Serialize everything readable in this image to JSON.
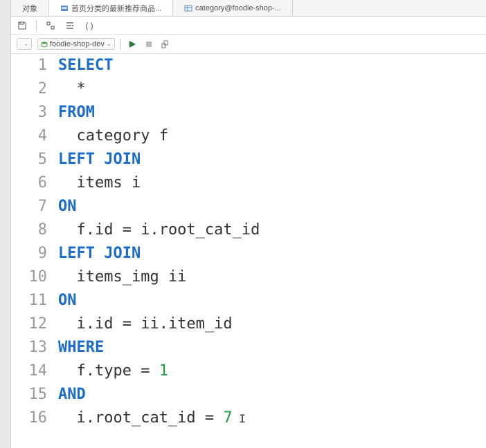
{
  "tabs": {
    "t0": "对象",
    "t1": "首页分类的最新推荐商品...",
    "t2": "category@foodie-shop-..."
  },
  "db_selector": {
    "current": "foodie-shop-dev"
  },
  "code": {
    "lines": [
      {
        "n": 1,
        "segs": [
          {
            "t": "SELECT",
            "c": "kw"
          }
        ]
      },
      {
        "n": 2,
        "segs": [
          {
            "t": "  *",
            "c": ""
          }
        ]
      },
      {
        "n": 3,
        "segs": [
          {
            "t": "FROM",
            "c": "kw"
          }
        ]
      },
      {
        "n": 4,
        "segs": [
          {
            "t": "  category f",
            "c": ""
          }
        ]
      },
      {
        "n": 5,
        "segs": [
          {
            "t": "LEFT JOIN",
            "c": "kw"
          }
        ]
      },
      {
        "n": 6,
        "segs": [
          {
            "t": "  items i",
            "c": ""
          }
        ]
      },
      {
        "n": 7,
        "segs": [
          {
            "t": "ON",
            "c": "kw"
          }
        ]
      },
      {
        "n": 8,
        "segs": [
          {
            "t": "  f.id = i.root_cat_id",
            "c": ""
          }
        ]
      },
      {
        "n": 9,
        "segs": [
          {
            "t": "LEFT JOIN",
            "c": "kw"
          }
        ]
      },
      {
        "n": 10,
        "segs": [
          {
            "t": "  items_img ii",
            "c": ""
          }
        ]
      },
      {
        "n": 11,
        "segs": [
          {
            "t": "ON",
            "c": "kw"
          }
        ]
      },
      {
        "n": 12,
        "segs": [
          {
            "t": "  i.id = ii.item_id",
            "c": ""
          }
        ]
      },
      {
        "n": 13,
        "segs": [
          {
            "t": "WHERE",
            "c": "kw"
          }
        ]
      },
      {
        "n": 14,
        "segs": [
          {
            "t": "  f.type = ",
            "c": ""
          },
          {
            "t": "1",
            "c": "num"
          }
        ]
      },
      {
        "n": 15,
        "segs": [
          {
            "t": "AND",
            "c": "kw"
          }
        ]
      },
      {
        "n": 16,
        "segs": [
          {
            "t": "  i.root_cat_id = ",
            "c": ""
          },
          {
            "t": "7",
            "c": "num"
          }
        ],
        "cursor": true
      }
    ]
  }
}
